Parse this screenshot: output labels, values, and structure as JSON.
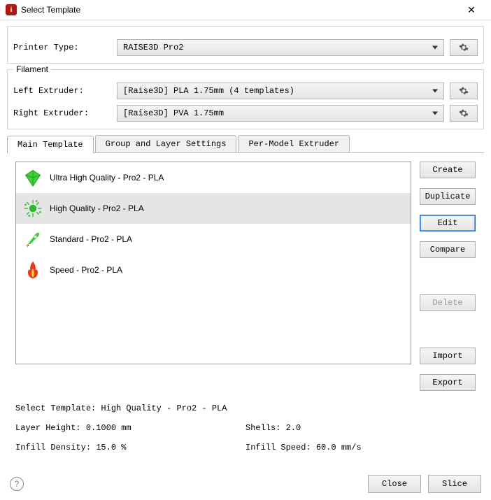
{
  "window": {
    "title": "Select Template"
  },
  "printerType": {
    "label": "Printer Type:",
    "value": "RAISE3D Pro2"
  },
  "filament": {
    "legend": "Filament",
    "leftExtruder": {
      "label": "Left Extruder:",
      "value": "[Raise3D] PLA 1.75mm (4 templates)"
    },
    "rightExtruder": {
      "label": "Right Extruder:",
      "value": "[Raise3D] PVA 1.75mm"
    }
  },
  "tabs": [
    {
      "label": "Main Template"
    },
    {
      "label": "Group and Layer Settings"
    },
    {
      "label": "Per-Model Extruder"
    }
  ],
  "templates": {
    "items": [
      {
        "name": "Ultra High Quality - Pro2 - PLA",
        "icon": "diamond"
      },
      {
        "name": "High Quality - Pro2 - PLA",
        "icon": "burst"
      },
      {
        "name": "Standard - Pro2 - PLA",
        "icon": "rocket"
      },
      {
        "name": "Speed - Pro2 - PLA",
        "icon": "flame"
      }
    ],
    "selectedIndex": 1
  },
  "buttons": {
    "create": "Create",
    "duplicate": "Duplicate",
    "edit": "Edit",
    "compare": "Compare",
    "delete": "Delete",
    "import": "Import",
    "export": "Export"
  },
  "info": {
    "selectLabel": "Select Template:",
    "selectValue": "High Quality - Pro2 - PLA",
    "layerHeightLabel": "Layer Height:",
    "layerHeightValue": "0.1000 mm",
    "shellsLabel": "Shells:",
    "shellsValue": "2.0",
    "infillDensityLabel": "Infill Density:",
    "infillDensityValue": "15.0 %",
    "infillSpeedLabel": "Infill Speed:",
    "infillSpeedValue": "60.0 mm/s"
  },
  "footer": {
    "close": "Close",
    "slice": "Slice"
  }
}
